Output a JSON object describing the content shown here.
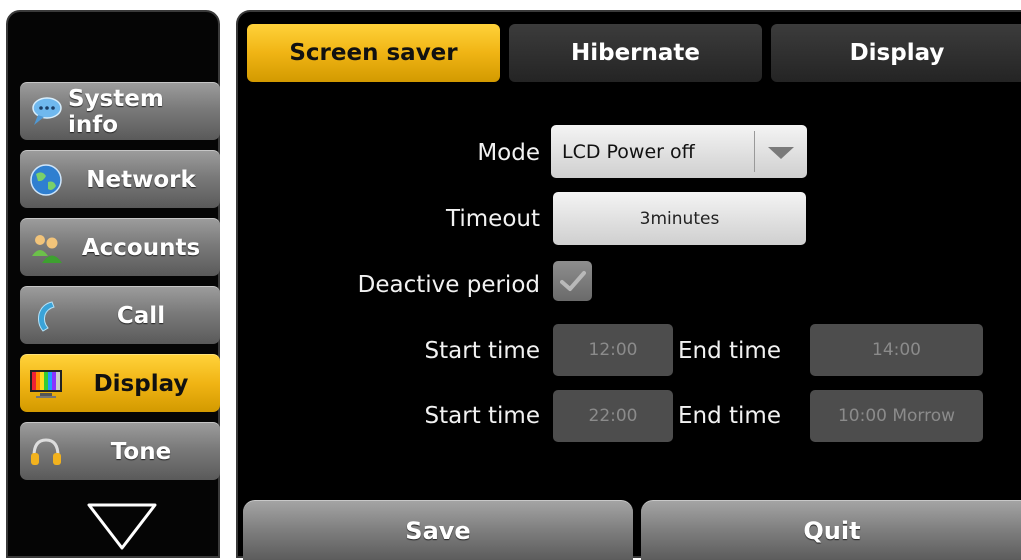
{
  "sidebar": {
    "items": [
      {
        "label": "System info",
        "icon": "chat-bubble-icon"
      },
      {
        "label": "Network",
        "icon": "globe-icon"
      },
      {
        "label": "Accounts",
        "icon": "users-icon"
      },
      {
        "label": "Call",
        "icon": "phone-handset-icon"
      },
      {
        "label": "Display",
        "icon": "color-bars-monitor-icon",
        "active": true
      },
      {
        "label": "Tone",
        "icon": "headphones-icon"
      }
    ],
    "scroll_icon": "triangle-down-icon"
  },
  "tabs": [
    {
      "label": "Screen saver",
      "active": true
    },
    {
      "label": "Hibernate"
    },
    {
      "label": "Display"
    }
  ],
  "form": {
    "mode": {
      "label": "Mode",
      "value": "LCD Power off"
    },
    "timeout": {
      "label": "Timeout",
      "value": "3minutes"
    },
    "deactive_period": {
      "label": "Deactive period",
      "checked": true
    },
    "periods": [
      {
        "start_label": "Start time",
        "start_value": "12:00",
        "end_label": "End time",
        "end_value": "14:00"
      },
      {
        "start_label": "Start time",
        "start_value": "22:00",
        "end_label": "End time",
        "end_value": "10:00 Morrow"
      }
    ]
  },
  "footer": {
    "save_label": "Save",
    "quit_label": "Quit"
  },
  "colors": {
    "accent": "#f0b414",
    "background": "#000000",
    "button_gray": "#7e7e7e",
    "disabled_field": "#4d4d4d"
  }
}
